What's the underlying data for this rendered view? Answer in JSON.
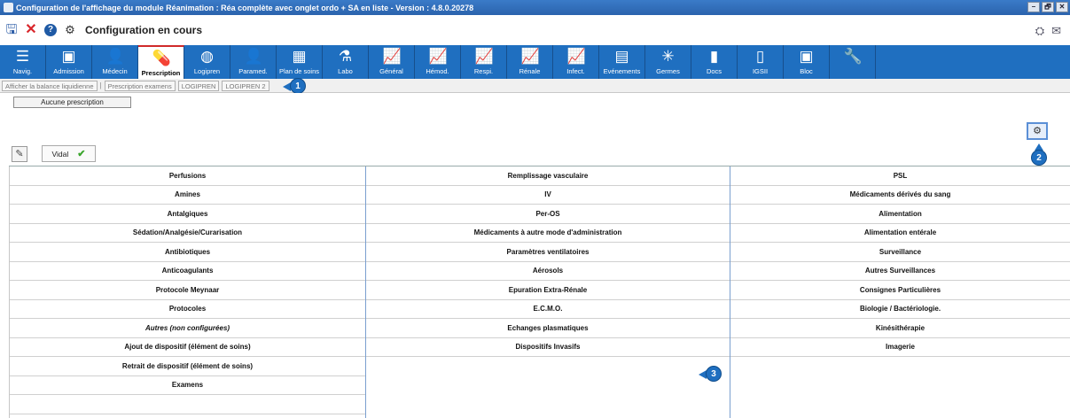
{
  "window": {
    "title": "Configuration de l'affichage du module Réanimation : Réa complète avec onglet ordo + SA en liste - Version : 4.8.0.20278",
    "buttons": [
      "–",
      "🗗",
      "✕"
    ]
  },
  "toolbar": {
    "title": "Configuration en cours",
    "icons": [
      "save-icon",
      "close-icon",
      "help-icon",
      "settings-icon"
    ],
    "right_icons": [
      "user-icon",
      "mail-icon"
    ]
  },
  "tabs": [
    {
      "label": "Navig.",
      "icon": "☰"
    },
    {
      "label": "Admission",
      "icon": "▣"
    },
    {
      "label": "Médecin",
      "icon": "👤"
    },
    {
      "label": "Prescription",
      "icon": "💊",
      "active": true
    },
    {
      "label": "Logipren",
      "icon": "◍"
    },
    {
      "label": "Paramed.",
      "icon": "👤"
    },
    {
      "label": "Plan de soins",
      "icon": "▦"
    },
    {
      "label": "Labo",
      "icon": "⚗"
    },
    {
      "label": "Général",
      "icon": "📈"
    },
    {
      "label": "Hémod.",
      "icon": "📈"
    },
    {
      "label": "Respi.",
      "icon": "📈"
    },
    {
      "label": "Rénale",
      "icon": "📈"
    },
    {
      "label": "Infect.",
      "icon": "📈"
    },
    {
      "label": "Evénements",
      "icon": "▤"
    },
    {
      "label": "Germes",
      "icon": "✳"
    },
    {
      "label": "Docs",
      "icon": "▮"
    },
    {
      "label": "IGSII",
      "icon": "▯"
    },
    {
      "label": "Bloc",
      "icon": "▣"
    },
    {
      "label": "",
      "icon": "🔧"
    }
  ],
  "subtabs": [
    "Afficher la balance liquidienne",
    "Prescription examens",
    "LOGIPREN",
    "LOGIPREN 2"
  ],
  "callouts": [
    "1",
    "2",
    "3"
  ],
  "prescription": {
    "empty_label": "Aucune prescription",
    "vidal_label": "Vidal",
    "check": "✔",
    "edit_icon": "✎",
    "settings_icon": "⚙"
  },
  "grid": {
    "col1": [
      {
        "label": "Perfusions"
      },
      {
        "label": "Amines"
      },
      {
        "label": "Antalgiques"
      },
      {
        "label": "Sédation/Analgésie/Curarisation"
      },
      {
        "label": "Antibiotiques"
      },
      {
        "label": "Anticoagulants"
      },
      {
        "label": "Protocole Meynaar"
      },
      {
        "label": "Protocoles"
      },
      {
        "label": "Autres (non configurées)",
        "italic": true
      },
      {
        "label": "Ajout de dispositif (élément de soins)"
      },
      {
        "label": "Retrait de dispositif (élément de soins)"
      },
      {
        "label": "Examens"
      },
      {
        "label": ""
      }
    ],
    "col2": [
      {
        "label": "Remplissage vasculaire"
      },
      {
        "label": "IV"
      },
      {
        "label": "Per-OS"
      },
      {
        "label": "Médicaments à autre mode d'administration"
      },
      {
        "label": "Paramètres ventilatoires"
      },
      {
        "label": "Aérosols"
      },
      {
        "label": "Epuration Extra-Rénale"
      },
      {
        "label": "E.C.M.O."
      },
      {
        "label": "Echanges plasmatiques"
      },
      {
        "label": "Dispositifs Invasifs"
      }
    ],
    "col3": [
      {
        "label": "PSL"
      },
      {
        "label": "Médicaments dérivés du sang"
      },
      {
        "label": "Alimentation"
      },
      {
        "label": "Alimentation entérale"
      },
      {
        "label": "Surveillance"
      },
      {
        "label": "Autres Surveillances"
      },
      {
        "label": "Consignes Particulières"
      },
      {
        "label": "Biologie / Bactériologie."
      },
      {
        "label": "Kinésithérapie"
      },
      {
        "label": "Imagerie"
      }
    ]
  },
  "colors": {
    "tabbar": "#1f6fc0",
    "titlebar": "#2b63ad",
    "active_tab_border": "#d02a2a",
    "callout": "#1f6fc0"
  }
}
